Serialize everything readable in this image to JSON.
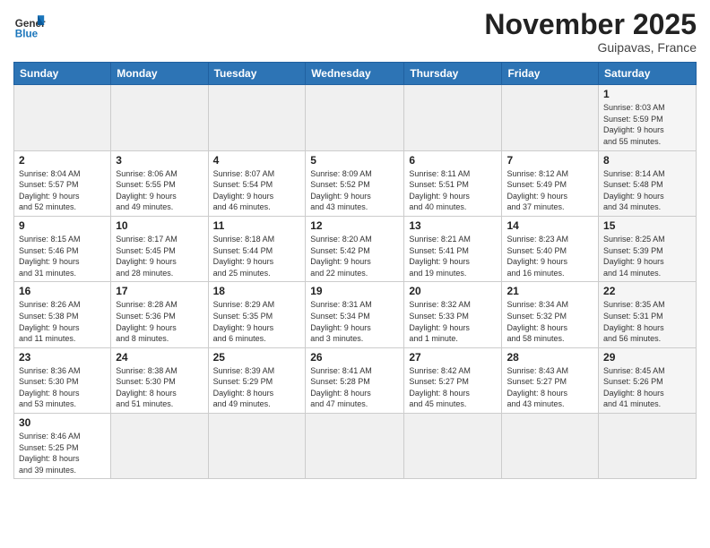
{
  "header": {
    "logo_general": "General",
    "logo_blue": "Blue",
    "month_title": "November 2025",
    "location": "Guipavas, France"
  },
  "weekdays": [
    "Sunday",
    "Monday",
    "Tuesday",
    "Wednesday",
    "Thursday",
    "Friday",
    "Saturday"
  ],
  "weeks": [
    [
      {
        "day": "",
        "info": "",
        "empty": true
      },
      {
        "day": "",
        "info": "",
        "empty": true
      },
      {
        "day": "",
        "info": "",
        "empty": true
      },
      {
        "day": "",
        "info": "",
        "empty": true
      },
      {
        "day": "",
        "info": "",
        "empty": true
      },
      {
        "day": "",
        "info": "",
        "empty": true
      },
      {
        "day": "1",
        "info": "Sunrise: 8:03 AM\nSunset: 5:59 PM\nDaylight: 9 hours\nand 55 minutes.",
        "shade": true
      }
    ],
    [
      {
        "day": "2",
        "info": "Sunrise: 8:04 AM\nSunset: 5:57 PM\nDaylight: 9 hours\nand 52 minutes."
      },
      {
        "day": "3",
        "info": "Sunrise: 8:06 AM\nSunset: 5:55 PM\nDaylight: 9 hours\nand 49 minutes."
      },
      {
        "day": "4",
        "info": "Sunrise: 8:07 AM\nSunset: 5:54 PM\nDaylight: 9 hours\nand 46 minutes."
      },
      {
        "day": "5",
        "info": "Sunrise: 8:09 AM\nSunset: 5:52 PM\nDaylight: 9 hours\nand 43 minutes."
      },
      {
        "day": "6",
        "info": "Sunrise: 8:11 AM\nSunset: 5:51 PM\nDaylight: 9 hours\nand 40 minutes."
      },
      {
        "day": "7",
        "info": "Sunrise: 8:12 AM\nSunset: 5:49 PM\nDaylight: 9 hours\nand 37 minutes."
      },
      {
        "day": "8",
        "info": "Sunrise: 8:14 AM\nSunset: 5:48 PM\nDaylight: 9 hours\nand 34 minutes.",
        "shade": true
      }
    ],
    [
      {
        "day": "9",
        "info": "Sunrise: 8:15 AM\nSunset: 5:46 PM\nDaylight: 9 hours\nand 31 minutes."
      },
      {
        "day": "10",
        "info": "Sunrise: 8:17 AM\nSunset: 5:45 PM\nDaylight: 9 hours\nand 28 minutes."
      },
      {
        "day": "11",
        "info": "Sunrise: 8:18 AM\nSunset: 5:44 PM\nDaylight: 9 hours\nand 25 minutes."
      },
      {
        "day": "12",
        "info": "Sunrise: 8:20 AM\nSunset: 5:42 PM\nDaylight: 9 hours\nand 22 minutes."
      },
      {
        "day": "13",
        "info": "Sunrise: 8:21 AM\nSunset: 5:41 PM\nDaylight: 9 hours\nand 19 minutes."
      },
      {
        "day": "14",
        "info": "Sunrise: 8:23 AM\nSunset: 5:40 PM\nDaylight: 9 hours\nand 16 minutes."
      },
      {
        "day": "15",
        "info": "Sunrise: 8:25 AM\nSunset: 5:39 PM\nDaylight: 9 hours\nand 14 minutes.",
        "shade": true
      }
    ],
    [
      {
        "day": "16",
        "info": "Sunrise: 8:26 AM\nSunset: 5:38 PM\nDaylight: 9 hours\nand 11 minutes."
      },
      {
        "day": "17",
        "info": "Sunrise: 8:28 AM\nSunset: 5:36 PM\nDaylight: 9 hours\nand 8 minutes."
      },
      {
        "day": "18",
        "info": "Sunrise: 8:29 AM\nSunset: 5:35 PM\nDaylight: 9 hours\nand 6 minutes."
      },
      {
        "day": "19",
        "info": "Sunrise: 8:31 AM\nSunset: 5:34 PM\nDaylight: 9 hours\nand 3 minutes."
      },
      {
        "day": "20",
        "info": "Sunrise: 8:32 AM\nSunset: 5:33 PM\nDaylight: 9 hours\nand 1 minute."
      },
      {
        "day": "21",
        "info": "Sunrise: 8:34 AM\nSunset: 5:32 PM\nDaylight: 8 hours\nand 58 minutes."
      },
      {
        "day": "22",
        "info": "Sunrise: 8:35 AM\nSunset: 5:31 PM\nDaylight: 8 hours\nand 56 minutes.",
        "shade": true
      }
    ],
    [
      {
        "day": "23",
        "info": "Sunrise: 8:36 AM\nSunset: 5:30 PM\nDaylight: 8 hours\nand 53 minutes."
      },
      {
        "day": "24",
        "info": "Sunrise: 8:38 AM\nSunset: 5:30 PM\nDaylight: 8 hours\nand 51 minutes."
      },
      {
        "day": "25",
        "info": "Sunrise: 8:39 AM\nSunset: 5:29 PM\nDaylight: 8 hours\nand 49 minutes."
      },
      {
        "day": "26",
        "info": "Sunrise: 8:41 AM\nSunset: 5:28 PM\nDaylight: 8 hours\nand 47 minutes."
      },
      {
        "day": "27",
        "info": "Sunrise: 8:42 AM\nSunset: 5:27 PM\nDaylight: 8 hours\nand 45 minutes."
      },
      {
        "day": "28",
        "info": "Sunrise: 8:43 AM\nSunset: 5:27 PM\nDaylight: 8 hours\nand 43 minutes."
      },
      {
        "day": "29",
        "info": "Sunrise: 8:45 AM\nSunset: 5:26 PM\nDaylight: 8 hours\nand 41 minutes.",
        "shade": true
      }
    ],
    [
      {
        "day": "30",
        "info": "Sunrise: 8:46 AM\nSunset: 5:25 PM\nDaylight: 8 hours\nand 39 minutes."
      },
      {
        "day": "",
        "info": "",
        "empty": true
      },
      {
        "day": "",
        "info": "",
        "empty": true
      },
      {
        "day": "",
        "info": "",
        "empty": true
      },
      {
        "day": "",
        "info": "",
        "empty": true
      },
      {
        "day": "",
        "info": "",
        "empty": true
      },
      {
        "day": "",
        "info": "",
        "empty": true
      }
    ]
  ]
}
